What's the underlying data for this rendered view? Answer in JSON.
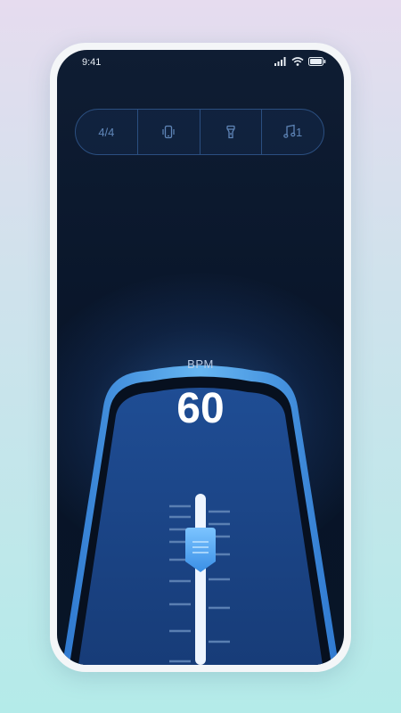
{
  "status_bar": {
    "time": "9:41"
  },
  "toolbar": {
    "time_signature": "4/4",
    "vibrate_icon": "vibrate-icon",
    "flashlight_icon": "flashlight-icon",
    "sound_label": "1",
    "sound_icon": "music-note-icon"
  },
  "metronome": {
    "label": "BPM",
    "value": "60"
  },
  "colors": {
    "accent": "#4a9fe8",
    "background": "#081428"
  }
}
